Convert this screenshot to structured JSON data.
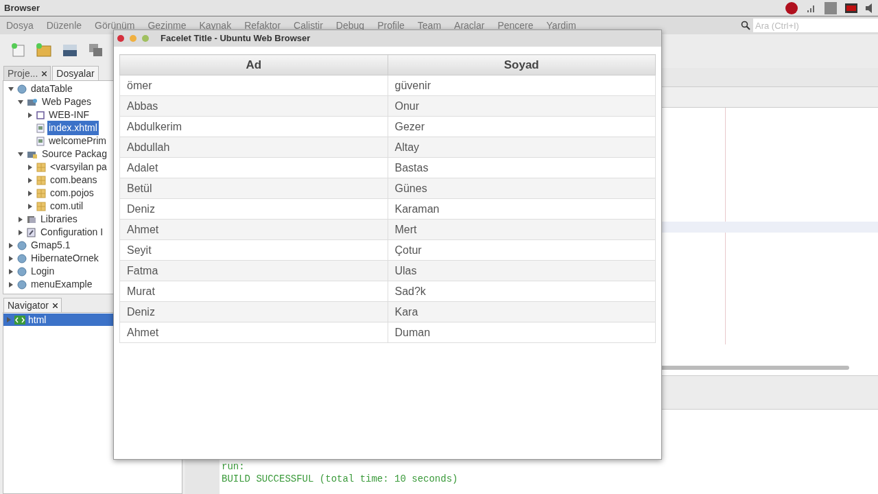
{
  "topbar": {
    "title": "Browser"
  },
  "menu": [
    "Dosya",
    "Düzenle",
    "Görünüm",
    "Gezinme",
    "Kaynak",
    "Refaktor",
    "Calistir",
    "Debug",
    "Profile",
    "Team",
    "Araclar",
    "Pencere",
    "Yardim"
  ],
  "search": {
    "placeholder": "Ara (Ctrl+I)"
  },
  "project_tabs": [
    {
      "label": "Proje...",
      "selected": false,
      "closable": true
    },
    {
      "label": "Dosyalar",
      "selected": true,
      "closable": false
    }
  ],
  "tree": [
    {
      "label": "dataTable",
      "kind": "project",
      "expanded": true,
      "selected": false,
      "children": [
        {
          "label": "Web Pages",
          "kind": "webfolder",
          "expanded": true,
          "selected": false,
          "children": [
            {
              "label": "WEB-INF",
              "kind": "folder",
              "expanded": false,
              "selected": false
            },
            {
              "label": "index.xhtml",
              "kind": "file",
              "selected": true
            },
            {
              "label": "welcomePrim",
              "kind": "file",
              "selected": false
            }
          ]
        },
        {
          "label": "Source Packag",
          "kind": "sources",
          "expanded": true,
          "selected": false,
          "children": [
            {
              "label": "<varsyilan pa",
              "kind": "package",
              "expanded": false,
              "selected": false
            },
            {
              "label": "com.beans",
              "kind": "package",
              "expanded": false,
              "selected": false
            },
            {
              "label": "com.pojos",
              "kind": "package",
              "expanded": false,
              "selected": false
            },
            {
              "label": "com.util",
              "kind": "package",
              "expanded": false,
              "selected": false
            }
          ]
        },
        {
          "label": "Libraries",
          "kind": "library",
          "expanded": false,
          "selected": false
        },
        {
          "label": "Configuration I",
          "kind": "config",
          "expanded": false,
          "selected": false
        }
      ]
    },
    {
      "label": "Gmap5.1",
      "kind": "project",
      "expanded": false,
      "selected": false
    },
    {
      "label": "HibernateOrnek",
      "kind": "project",
      "expanded": false,
      "selected": false
    },
    {
      "label": "Login",
      "kind": "project",
      "expanded": false,
      "selected": false
    },
    {
      "label": "menuExample",
      "kind": "project",
      "expanded": false,
      "selected": false
    }
  ],
  "navigator": {
    "tab": "Navigator",
    "items": [
      {
        "label": "html",
        "expanded": false,
        "selected": true
      }
    ]
  },
  "output": [
    "run:",
    "BUILD SUCCESSFUL (total time: 10 seconds)"
  ],
  "browser": {
    "title": "Facelet Title - Ubuntu Web Browser",
    "columns": [
      "Ad",
      "Soyad"
    ],
    "rows": [
      [
        "ömer",
        "güvenir"
      ],
      [
        "Abbas",
        "Onur"
      ],
      [
        "Abdulkerim",
        "Gezer"
      ],
      [
        "Abdullah",
        "Altay"
      ],
      [
        "Adalet",
        "Bastas"
      ],
      [
        "Betül",
        "Günes"
      ],
      [
        "Deniz",
        "Karaman"
      ],
      [
        "Ahmet",
        "Mert"
      ],
      [
        "Seyit",
        "Çotur"
      ],
      [
        "Fatma",
        "Ulas"
      ],
      [
        "Murat",
        "Sad?k"
      ],
      [
        "Deniz",
        "Kara"
      ],
      [
        "Ahmet",
        "Duman"
      ]
    ]
  }
}
